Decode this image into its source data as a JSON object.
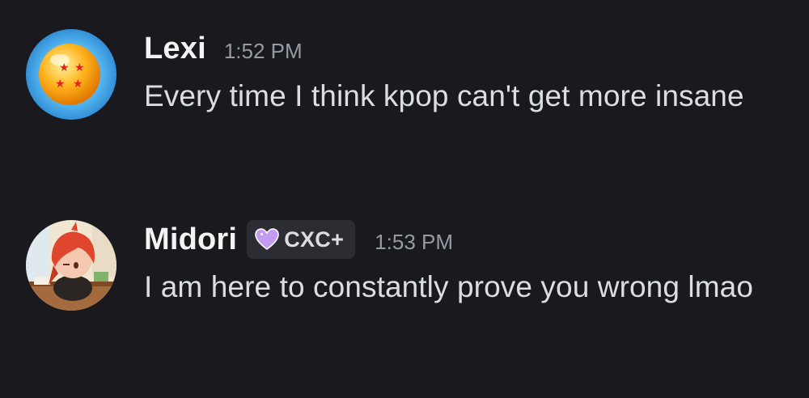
{
  "messages": [
    {
      "username": "Lexi",
      "timestamp": "1:52 PM",
      "text": "Every time I think kpop can't get more insane",
      "avatar_icon": "dragon-ball-avatar"
    },
    {
      "username": "Midori",
      "timestamp": "1:53 PM",
      "tag": {
        "icon": "heart-icon",
        "label": "CXC+"
      },
      "text": "I am here to constantly prove you wrong lmao",
      "avatar_icon": "anime-character-avatar"
    }
  ],
  "colors": {
    "background": "#1a1a1e",
    "username": "#f2f3f5",
    "timestamp": "#949ba4",
    "text": "#dbdee1",
    "tag_background": "#2b2d33",
    "heart": "#c49bf2"
  }
}
